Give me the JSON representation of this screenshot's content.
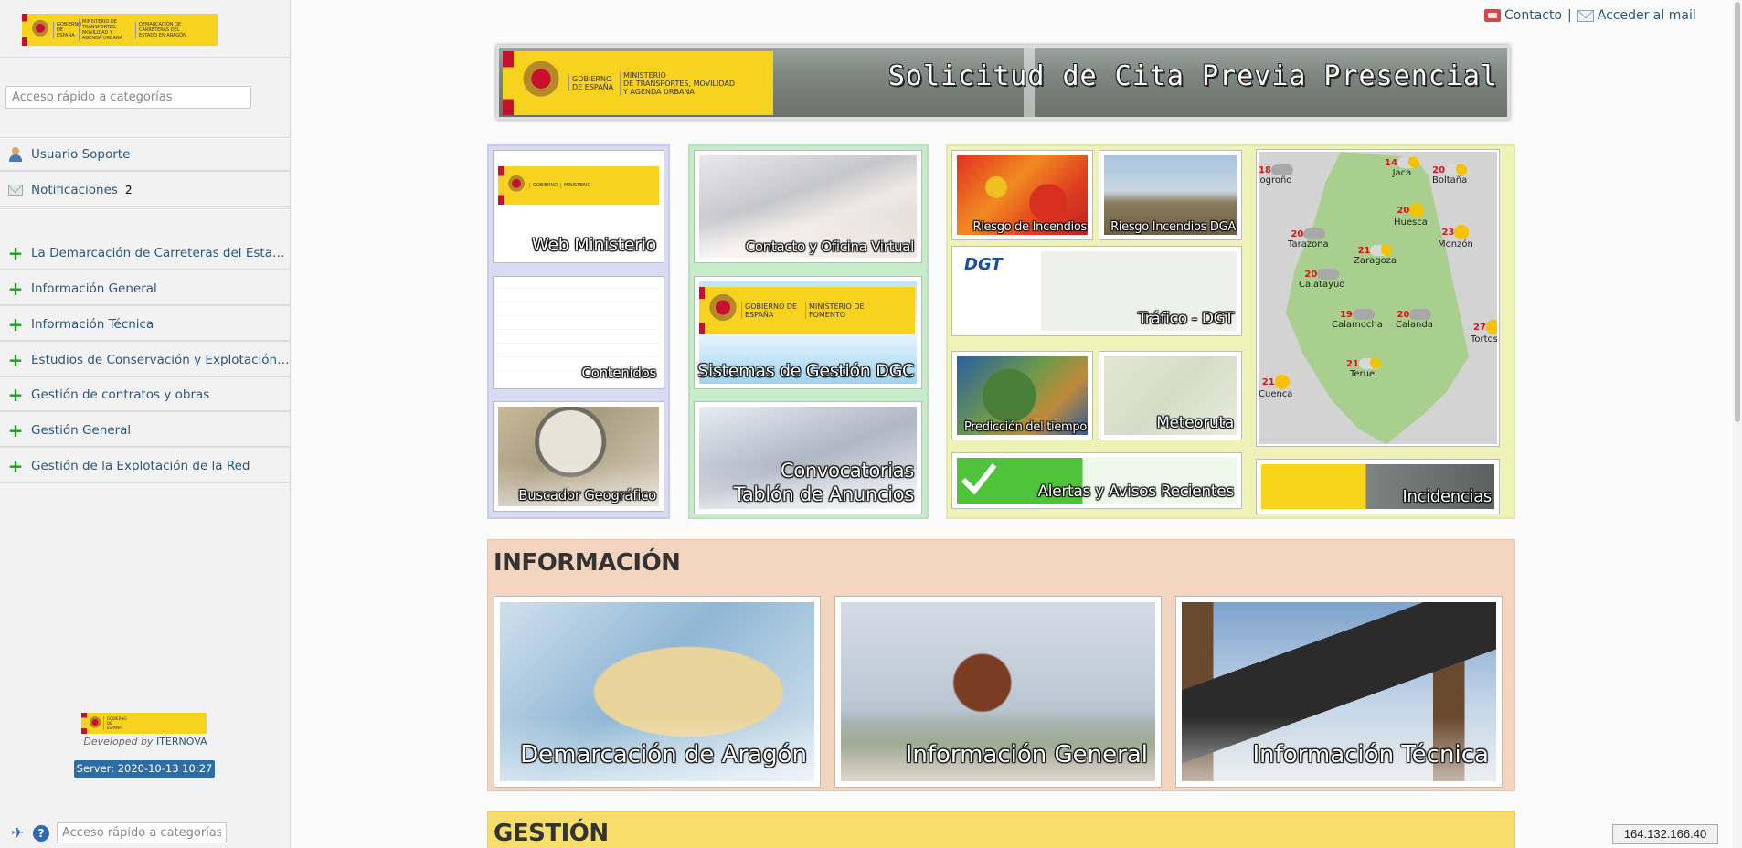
{
  "sidebar": {
    "search_placeholder": "Acceso rápido a categorías",
    "user": "Usuario Soporte",
    "notifications_label": "Notificaciones",
    "notifications_count": "2",
    "categories": [
      "La Demarcación de Carreteras del Estado en ...",
      "Información General",
      "Información Técnica",
      "Estudios de Conservación y Explotación de C...",
      "Gestión de contratos y obras",
      "Gestión General",
      "Gestión de la Explotación de la Red"
    ],
    "developed_by_prefix": "Developed by",
    "developer": "ITERNOVA",
    "server": "Server: 2020-10-13 10:27",
    "bottom_search_placeholder": "Acceso rápido a categorías"
  },
  "top_links": {
    "contact": "Contacto",
    "separator": "|",
    "mail": "Acceder al mail"
  },
  "banner": {
    "title": "Solicitud de Cita Previa Presencial",
    "logo_lines": [
      "GOBIERNO",
      "DE ESPAÑA",
      "MINISTERIO",
      "DE TRANSPORTES, MOVILIDAD",
      "Y AGENDA URBANA"
    ]
  },
  "logos": {
    "sidebar_logo_lines": [
      "GOBIERNO DE ESPAÑA",
      "MINISTERIO DE TRANSPORTES, MOVILIDAD Y AGENDA URBANA",
      "DEMARCACIÓN DE CARRETERAS DEL ESTADO EN ARAGÓN"
    ],
    "dgc_logo_lines": [
      "GOBIERNO DE ESPAÑA",
      "MINISTERIO DE FOMENTO"
    ],
    "dgt_logo": "DGT"
  },
  "tiles": {
    "web_ministerio": "Web Ministerio",
    "contenidos": "Contenidos",
    "buscador": "Buscador Geográfico",
    "contacto": "Contacto y Oficina Virtual",
    "sistemas": "Sistemas de Gestión DGC",
    "convocatorias_1": "Convocatorias",
    "convocatorias_2": "Tablón de Anuncios",
    "riesgo": "Riesgo de Incendios",
    "riesgo_dga": "Riesgo Incendios DGA",
    "trafico": "Tráfico - DGT",
    "prediccion": "Predicción del tiempo",
    "meteoruta": "Meteoruta",
    "alertas": "Alertas y Avisos Recientes",
    "incidencias": "Incidencias"
  },
  "weather": [
    {
      "temp": "18",
      "city": "ogroño",
      "icon": "cloud"
    },
    {
      "temp": "14",
      "city": "Jaca",
      "icon": "cloud-sun"
    },
    {
      "temp": "20",
      "city": "Boltaña",
      "icon": "cloud-sun"
    },
    {
      "temp": "20",
      "city": "Huesca",
      "icon": "sun"
    },
    {
      "temp": "23",
      "city": "Monzón",
      "icon": "sun"
    },
    {
      "temp": "20",
      "city": "Tarazona",
      "icon": "cloud"
    },
    {
      "temp": "21",
      "city": "Zaragoza",
      "icon": "cloud-sun"
    },
    {
      "temp": "20",
      "city": "Calatayud",
      "icon": "cloud"
    },
    {
      "temp": "19",
      "city": "Calamocha",
      "icon": "cloud"
    },
    {
      "temp": "20",
      "city": "Calanda",
      "icon": "cloud"
    },
    {
      "temp": "27",
      "city": "Tortosa",
      "icon": "sun"
    },
    {
      "temp": "21",
      "city": "Teruel",
      "icon": "cloud-sun"
    },
    {
      "temp": "21",
      "city": "Cuenca",
      "icon": "sun"
    }
  ],
  "sections": {
    "informacion": "INFORMACIÓN",
    "gestion": "GESTIÓN",
    "info_cards": [
      "Demarcación de Aragón",
      "Información General",
      "Información Técnica"
    ]
  },
  "ip": "164.132.166.40",
  "colors": {
    "link": "#2a5680",
    "plus": "#1e9e1e",
    "server_badge": "#2e6da4",
    "info_panel": "#f3d5bf",
    "gestion_panel": "#f7de6a"
  }
}
